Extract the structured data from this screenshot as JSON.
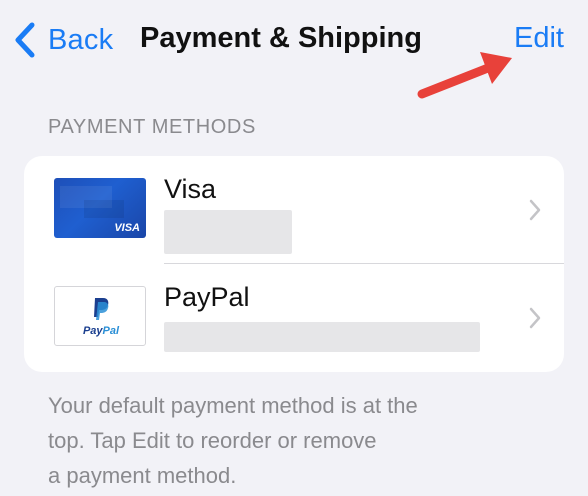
{
  "nav": {
    "back_label": "Back",
    "title": "Payment & Shipping",
    "edit_label": "Edit",
    "back_icon": "chevron-left-icon"
  },
  "annotation": {
    "icon": "red-arrow",
    "color": "#e8413a"
  },
  "section": {
    "header": "PAYMENT METHODS"
  },
  "payment_methods": [
    {
      "name": "Visa",
      "card_label": "VISA",
      "icon": "visa-card-icon"
    },
    {
      "name": "PayPal",
      "card_label_a": "Pay",
      "card_label_b": "Pal",
      "icon": "paypal-card-icon"
    }
  ],
  "footer": {
    "lines": [
      "Your default payment method is at the",
      "top. Tap Edit to reorder or remove",
      "a payment method."
    ]
  },
  "colors": {
    "accent": "#1a7cf5",
    "background": "#f2f2f7",
    "secondary_text": "#8a8a8e"
  }
}
